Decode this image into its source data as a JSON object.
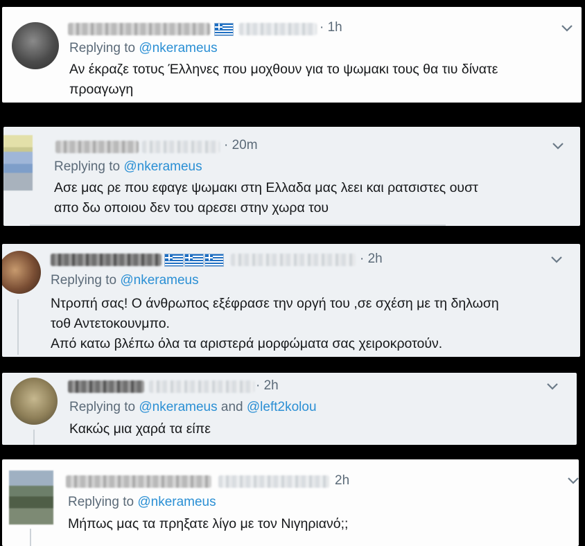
{
  "tweets": [
    {
      "time": "· 1h",
      "replying_prefix": "Replying to ",
      "reply_to": [
        "@nkerameus"
      ],
      "text": "Αν έκραζε τοτυς Έλληνες που μοχθουν για το ψωμακι τους θα τιυ δίνατε\nπροαγωγη",
      "flags": 1
    },
    {
      "time": "· 20m",
      "replying_prefix": "Replying to ",
      "reply_to": [
        "@nkerameus"
      ],
      "text": "Ασε μας ρε που εφαγε ψωμακι στη  Ελλαδα μας λεει και ρατσιστες ουστ\nαπο δω οποιου δεν του αρεσει στην χωρα του",
      "flags": 0
    },
    {
      "time": "· 2h",
      "replying_prefix": "Replying to ",
      "reply_to": [
        "@nkerameus"
      ],
      "text": "Ντροπή σας! Ο άνθρωπος εξέφρασε την οργή του ,σε σχέση με τη δηλωση\nτοθ Αντετοκουνμπο.\nΑπό κατω βλέπω όλα τα αριστερά μορφώματα σας χειροκροτούν.",
      "flags": 3
    },
    {
      "time": "· 2h",
      "replying_prefix": "Replying to ",
      "reply_to": [
        "@nkerameus",
        "@left2kolou"
      ],
      "joiner": " and ",
      "text": "Κακώς μια χαρά τα είπε",
      "flags": 0
    },
    {
      "time": "2h",
      "replying_prefix": "Replying to ",
      "reply_to": [
        "@nkerameus"
      ],
      "text": "Μήπως μας τα πρηξατε λίγο με τον Νιγηριανό;;",
      "flags": 0
    }
  ],
  "icons": {
    "chevron": "chevron-down-icon",
    "flag": "greek-flag-icon"
  },
  "colors": {
    "card_bg": "#ffffff",
    "card_bg_alt": "#eef1f4",
    "handle": "#2a8fd4",
    "muted": "#5b6a78",
    "text": "#16181a",
    "background": "#000000"
  }
}
